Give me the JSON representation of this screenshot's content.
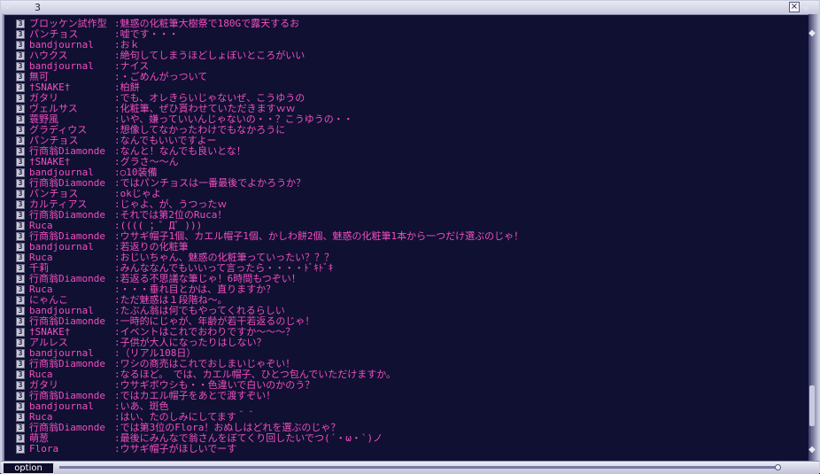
{
  "window": {
    "title": "3",
    "close_label": "×"
  },
  "ui": {
    "option_tab": "option",
    "badge_text": "3"
  },
  "icons": {
    "scroll_up": "diamond-up-icon",
    "scroll_down": "diamond-down-icon"
  },
  "colors": {
    "background": "#101032",
    "chat_text": "#f04fc0",
    "frame": "#c9cbe0"
  },
  "messages": [
    {
      "name": "ブロッケン試作型",
      "text": ":魅惑の化粧筆大樹祭で180Gで露天するお"
    },
    {
      "name": "パンチョス",
      "text": ":嘘です・・・"
    },
    {
      "name": "bandjournal",
      "text": ":おｋ"
    },
    {
      "name": "ハウクス",
      "text": ":絶句してしまうほどしょぼいところがいい"
    },
    {
      "name": "bandjournal",
      "text": ":ナイス"
    },
    {
      "name": "無可",
      "text": ":・ごめんがっついて"
    },
    {
      "name": "†SNAKE†",
      "text": ":柏餅"
    },
    {
      "name": "ガタリ",
      "text": ":でも、オレきらいじゃないぜ、こうゆうの"
    },
    {
      "name": "ヴェルサス",
      "text": ":化粧筆、ぜひ貰わせていただきますｗｗ"
    },
    {
      "name": "蓑野風",
      "text": ":いや、嫌っていいんじゃないの・・？こうゆうの・・"
    },
    {
      "name": "グラディウス",
      "text": ":想像してなかったわけでもなかろうに"
    },
    {
      "name": "パンチョス",
      "text": ":なんでもいいですよー"
    },
    {
      "name": "行商翁Diamonde",
      "text": ":なんと！なんでも良いとな！"
    },
    {
      "name": "†SNAKE†",
      "text": ":グラさ～～ん"
    },
    {
      "name": "bandjournal",
      "text": ":○10装備"
    },
    {
      "name": "行商翁Diamonde",
      "text": ":ではパンチョスは一番最後でよかろうか？"
    },
    {
      "name": "パンチョス",
      "text": ":okじゃよ"
    },
    {
      "name": "カルティアス",
      "text": ":じゃよ、が、うつったｗ"
    },
    {
      "name": "行商翁Diamonde",
      "text": ":それでは第2位のRuca！"
    },
    {
      "name": "Ruca",
      "text": ":(((( ；゜Д゜)))"
    },
    {
      "name": "行商翁Diamonde",
      "text": ":ウサギ帽子1個、カエル帽子1個、かしわ餅2個、魅惑の化粧筆1本から一つだけ選ぶのじゃ！"
    },
    {
      "name": "bandjournal",
      "text": ":若返りの化粧筆"
    },
    {
      "name": "Ruca",
      "text": ":おじいちゃん、魅惑の化粧筆っていったい？？？"
    },
    {
      "name": "千莉",
      "text": ":みんななんでもいいって言ったら・・・・ﾄﾞｷﾄﾞｷ"
    },
    {
      "name": "行商翁Diamonde",
      "text": ":若返る不思議な筆じゃ！6時間もつぞい！"
    },
    {
      "name": "Ruca",
      "text": ":・・・垂れ目とかは、直りますか？"
    },
    {
      "name": "にゃんこ",
      "text": ":ただ魅惑は１段階ね～。"
    },
    {
      "name": "bandjournal",
      "text": ":たぶん翁は何でもやってくれるらしい"
    },
    {
      "name": "行商翁Diamonde",
      "text": ":一時的にじゃが、年齢が若干若返るのじゃ！"
    },
    {
      "name": "†SNAKE†",
      "text": ":イベントはこれでおわりですか～～～？"
    },
    {
      "name": "アルレス",
      "text": ":子供が大人になったりはしない？"
    },
    {
      "name": "bandjournal",
      "text": ":（リアル108日）"
    },
    {
      "name": "行商翁Diamonde",
      "text": ":ワシの商売はこれでおしまいじゃぞい！"
    },
    {
      "name": "Ruca",
      "text": ":なるほど。　では、カエル帽子、ひとつ包んでいただけますか。"
    },
    {
      "name": "ガタリ",
      "text": ":ウサギボウシも・・色違いで白いのかのう？"
    },
    {
      "name": "行商翁Diamonde",
      "text": ":ではカエル帽子をあとで渡すぞい！"
    },
    {
      "name": "bandjournal",
      "text": ":いあ、斑色"
    },
    {
      "name": "Ruca",
      "text": ":はい、たのしみにしてます＾＾"
    },
    {
      "name": "行商翁Diamonde",
      "text": ":では第3位のFlora！おぬしはどれを選ぶのじゃ？"
    },
    {
      "name": "萌葱",
      "text": ":最後にみんなで翁さんをぼてくり回したいでつ(´・ω・`)ノ"
    },
    {
      "name": "Flora",
      "text": ":ウサギ帽子がほしいでーす"
    }
  ]
}
